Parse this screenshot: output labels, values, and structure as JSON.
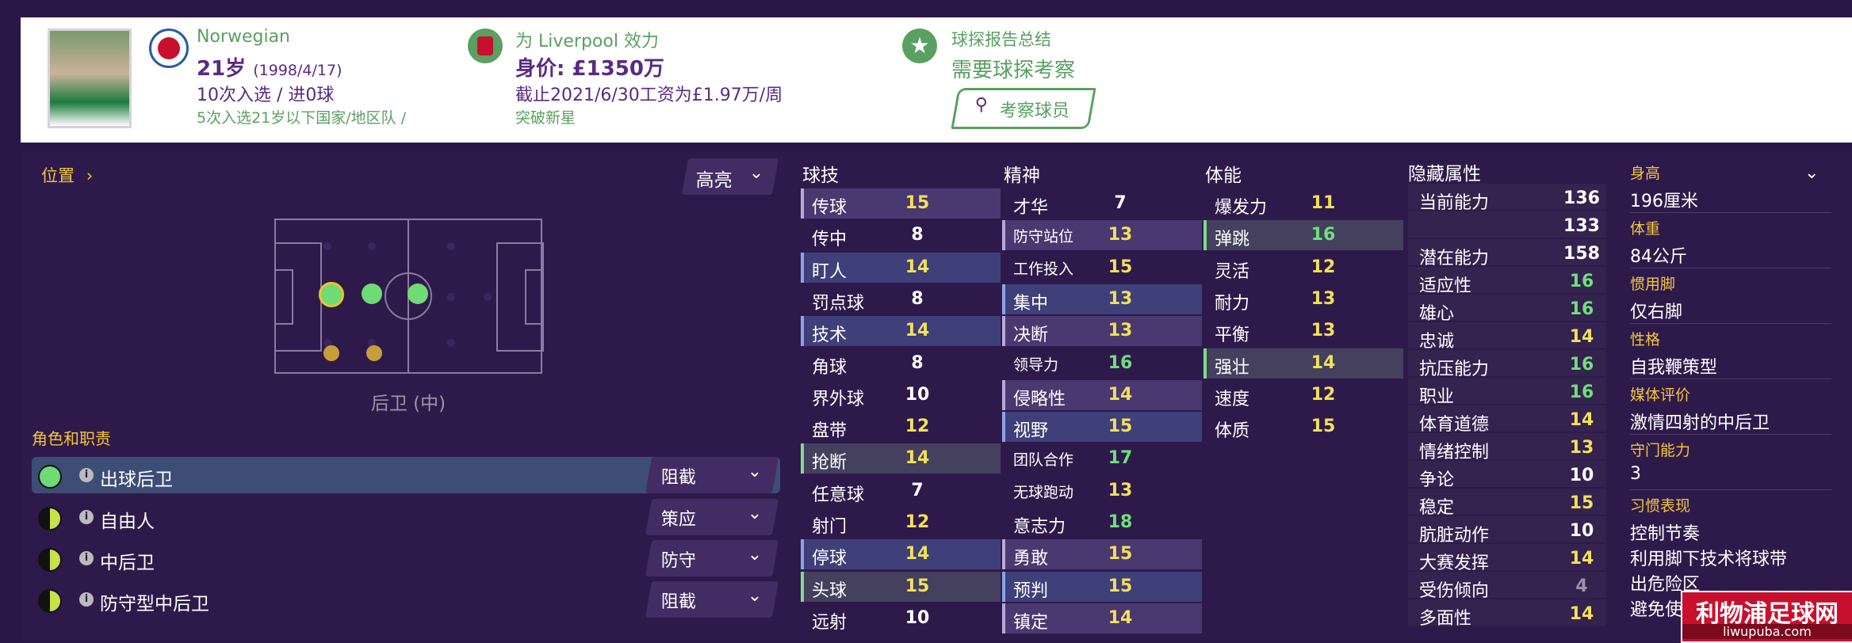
{
  "header": {
    "nationality": "Norwegian",
    "age_main": "21岁",
    "age_dob": "(1998/4/17)",
    "caps": "10次入选 / 进0球",
    "youth_caps": "5次入选21岁以下国家/地区队 /",
    "club_line": "为 Liverpool 效力",
    "value": "身价: £1350万",
    "contract": "截止2021/6/30工资为£1.97万/周",
    "tag": "突破新星",
    "scout_title": "球探报告总结",
    "scout_need": "需要球探考察",
    "scout_button": "考察球员"
  },
  "position_panel": {
    "position_label": "位置",
    "highlight_dropdown": "高亮",
    "position_name": "后卫 (中)",
    "roles_title": "角色和职责"
  },
  "roles": [
    {
      "name": "出球后卫",
      "duty": "阻截"
    },
    {
      "name": "自由人",
      "duty": "策应"
    },
    {
      "name": "中后卫",
      "duty": "防守"
    },
    {
      "name": "防守型中后卫",
      "duty": "阻截"
    }
  ],
  "technical": {
    "title": "球技",
    "rows": [
      {
        "name": "传球",
        "value": "15"
      },
      {
        "name": "传中",
        "value": "8"
      },
      {
        "name": "盯人",
        "value": "14"
      },
      {
        "name": "罚点球",
        "value": "8"
      },
      {
        "name": "技术",
        "value": "14"
      },
      {
        "name": "角球",
        "value": "8"
      },
      {
        "name": "界外球",
        "value": "10"
      },
      {
        "name": "盘带",
        "value": "12"
      },
      {
        "name": "抢断",
        "value": "14"
      },
      {
        "name": "任意球",
        "value": "7"
      },
      {
        "name": "射门",
        "value": "12"
      },
      {
        "name": "停球",
        "value": "14"
      },
      {
        "name": "头球",
        "value": "15"
      },
      {
        "name": "远射",
        "value": "10"
      }
    ]
  },
  "mental": {
    "title": "精神",
    "rows": [
      {
        "name": "才华",
        "value": "7"
      },
      {
        "name": "防守站位",
        "value": "13"
      },
      {
        "name": "工作投入",
        "value": "15"
      },
      {
        "name": "集中",
        "value": "13"
      },
      {
        "name": "决断",
        "value": "13"
      },
      {
        "name": "领导力",
        "value": "16"
      },
      {
        "name": "侵略性",
        "value": "14"
      },
      {
        "name": "视野",
        "value": "15"
      },
      {
        "name": "团队合作",
        "value": "17"
      },
      {
        "name": "无球跑动",
        "value": "13"
      },
      {
        "name": "意志力",
        "value": "18"
      },
      {
        "name": "勇敢",
        "value": "15"
      },
      {
        "name": "预判",
        "value": "15"
      },
      {
        "name": "镇定",
        "value": "14"
      }
    ]
  },
  "physical": {
    "title": "体能",
    "rows": [
      {
        "name": "爆发力",
        "value": "11"
      },
      {
        "name": "弹跳",
        "value": "16"
      },
      {
        "name": "灵活",
        "value": "12"
      },
      {
        "name": "耐力",
        "value": "13"
      },
      {
        "name": "平衡",
        "value": "13"
      },
      {
        "name": "强壮",
        "value": "14"
      },
      {
        "name": "速度",
        "value": "12"
      },
      {
        "name": "体质",
        "value": "15"
      }
    ]
  },
  "hidden": {
    "title": "隐藏属性",
    "rows": [
      {
        "name": "当前能力",
        "value": "136"
      },
      {
        "name": "",
        "value": "133"
      },
      {
        "name": "潜在能力",
        "value": "158"
      },
      {
        "name": "适应性",
        "value": "16"
      },
      {
        "name": "雄心",
        "value": "16"
      },
      {
        "name": "忠诚",
        "value": "14"
      },
      {
        "name": "抗压能力",
        "value": "16"
      },
      {
        "name": "职业",
        "value": "16"
      },
      {
        "name": "体育道德",
        "value": "14"
      },
      {
        "name": "情绪控制",
        "value": "13"
      },
      {
        "name": "争论",
        "value": "10"
      },
      {
        "name": "稳定",
        "value": "15"
      },
      {
        "name": "肮脏动作",
        "value": "10"
      },
      {
        "name": "大赛发挥",
        "value": "14"
      },
      {
        "name": "受伤倾向",
        "value": "4"
      },
      {
        "name": "多面性",
        "value": "14"
      }
    ]
  },
  "profile": {
    "height_label": "身高",
    "height": "196厘米",
    "weight_label": "体重",
    "weight": "84公斤",
    "foot_label": "惯用脚",
    "foot": "仅右脚",
    "personality_label": "性格",
    "personality": "自我鞭策型",
    "media_label": "媒体评价",
    "media": "激情四射的中后卫",
    "gk_label": "守门能力",
    "gk": "3",
    "habits_label": "习惯表现",
    "habits": [
      "控制节奏",
      "利用脚下技术将球带",
      "出危险区",
      "避免使"
    ]
  },
  "watermark": {
    "title": "利物浦足球网",
    "url": "liwupuba.com"
  },
  "colors": {
    "accent_yellow": "#f2e05a",
    "accent_green": "#6fe07a",
    "background": "#2b1747",
    "label_gold": "#f2c63e"
  }
}
